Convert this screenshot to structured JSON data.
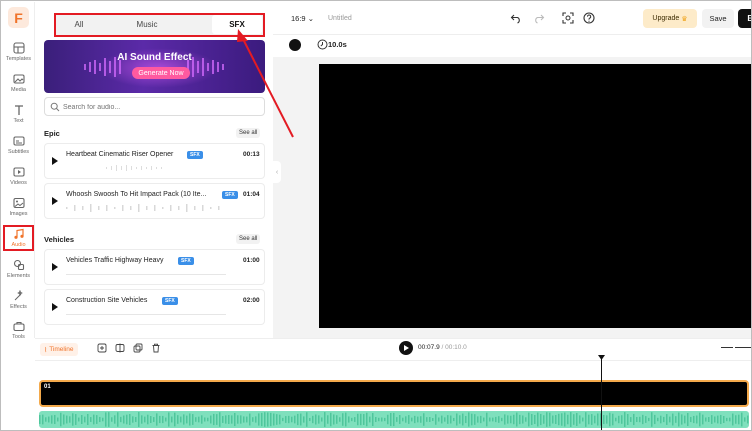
{
  "app": {
    "logo_letter": "F"
  },
  "rail": {
    "items": [
      {
        "label": "Templates",
        "icon": "templates-icon"
      },
      {
        "label": "Media",
        "icon": "media-icon"
      },
      {
        "label": "Text",
        "icon": "text-icon"
      },
      {
        "label": "Subtitles",
        "icon": "subtitles-icon"
      },
      {
        "label": "Videos",
        "icon": "videos-icon"
      },
      {
        "label": "Images",
        "icon": "images-icon"
      },
      {
        "label": "Audio",
        "icon": "music-note-icon",
        "active": true
      },
      {
        "label": "Elements",
        "icon": "elements-icon"
      },
      {
        "label": "Effects",
        "icon": "effects-icon"
      },
      {
        "label": "Tools",
        "icon": "tools-icon"
      }
    ],
    "active_color": "#f0732a"
  },
  "panel": {
    "tabs": [
      {
        "label": "All"
      },
      {
        "label": "Music"
      },
      {
        "label": "SFX",
        "active": true
      }
    ],
    "banner": {
      "title": "AI Sound Effect",
      "button": "Generate Now"
    },
    "search": {
      "placeholder": "Search for audio..."
    },
    "sections": [
      {
        "title": "Epic",
        "see_all": "See all",
        "items": [
          {
            "name": "Heartbeat Cinematic Riser Opener",
            "badge": "SFX",
            "duration": "00:13"
          },
          {
            "name": "Whoosh Swoosh To Hit Impact Pack (10 Ite...",
            "badge": "SFX",
            "duration": "01:04"
          }
        ]
      },
      {
        "title": "Vehicles",
        "see_all": "See all",
        "items": [
          {
            "name": "Vehicles Traffic Highway Heavy",
            "badge": "SFX",
            "duration": "01:00"
          },
          {
            "name": "Construction Site Vehicles",
            "badge": "SFX",
            "duration": "02:00"
          }
        ]
      }
    ]
  },
  "toolbar": {
    "ratio": "16:9",
    "title": "Untitled",
    "upgrade": "Upgrade",
    "save": "Save",
    "export": "E"
  },
  "subbar": {
    "duration": "10.0s"
  },
  "timeline": {
    "button": "Timeline",
    "current_time": "00:07.9",
    "total_time": "/ 00:10.0",
    "track_label": "01"
  },
  "colors": {
    "accent": "#f0732a",
    "annotation_red": "#e31b23",
    "sfx_badge": "#3a8fe8",
    "audio_track": "#7fe0bd",
    "video_track_border": "#f3a94b"
  }
}
